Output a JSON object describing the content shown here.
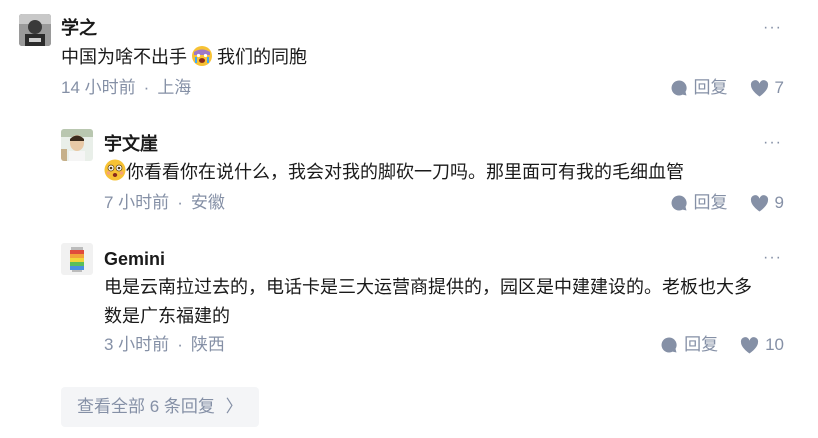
{
  "comments": [
    {
      "author": "学之",
      "more": "···",
      "content_before": "中国为啥不出手",
      "content_after": "我们的同胞",
      "time": "14 小时前",
      "sep": "·",
      "location": "上海",
      "reply_label": "回复",
      "likes": "7"
    },
    {
      "author": "宇文崖",
      "more": "···",
      "content": "你看看你在说什么，我会对我的脚砍一刀吗。那里面可有我的毛细血管",
      "time": "7 小时前",
      "sep": "·",
      "location": "安徽",
      "reply_label": "回复",
      "likes": "9"
    },
    {
      "author": "Gemini",
      "more": "···",
      "content_line1": "电是云南拉过去的，电话卡是三大运营商提供的，园区是中建建设的。老板也大多",
      "content_line2": "数是广东福建的",
      "time": "3 小时前",
      "sep": "·",
      "location": "陕西",
      "reply_label": "回复",
      "likes": "10"
    }
  ],
  "view_all": {
    "label": "查看全部 6 条回复",
    "chevron": "〉"
  },
  "icons": {
    "reply": "comment-bubble-icon",
    "like": "heart-icon",
    "emoji_crying": "crying-emoji-icon",
    "emoji_shocked": "flushed-emoji-icon"
  },
  "colors": {
    "muted": "#8590a6",
    "text": "#1a1a1a",
    "button_bg": "#f4f5f7"
  }
}
